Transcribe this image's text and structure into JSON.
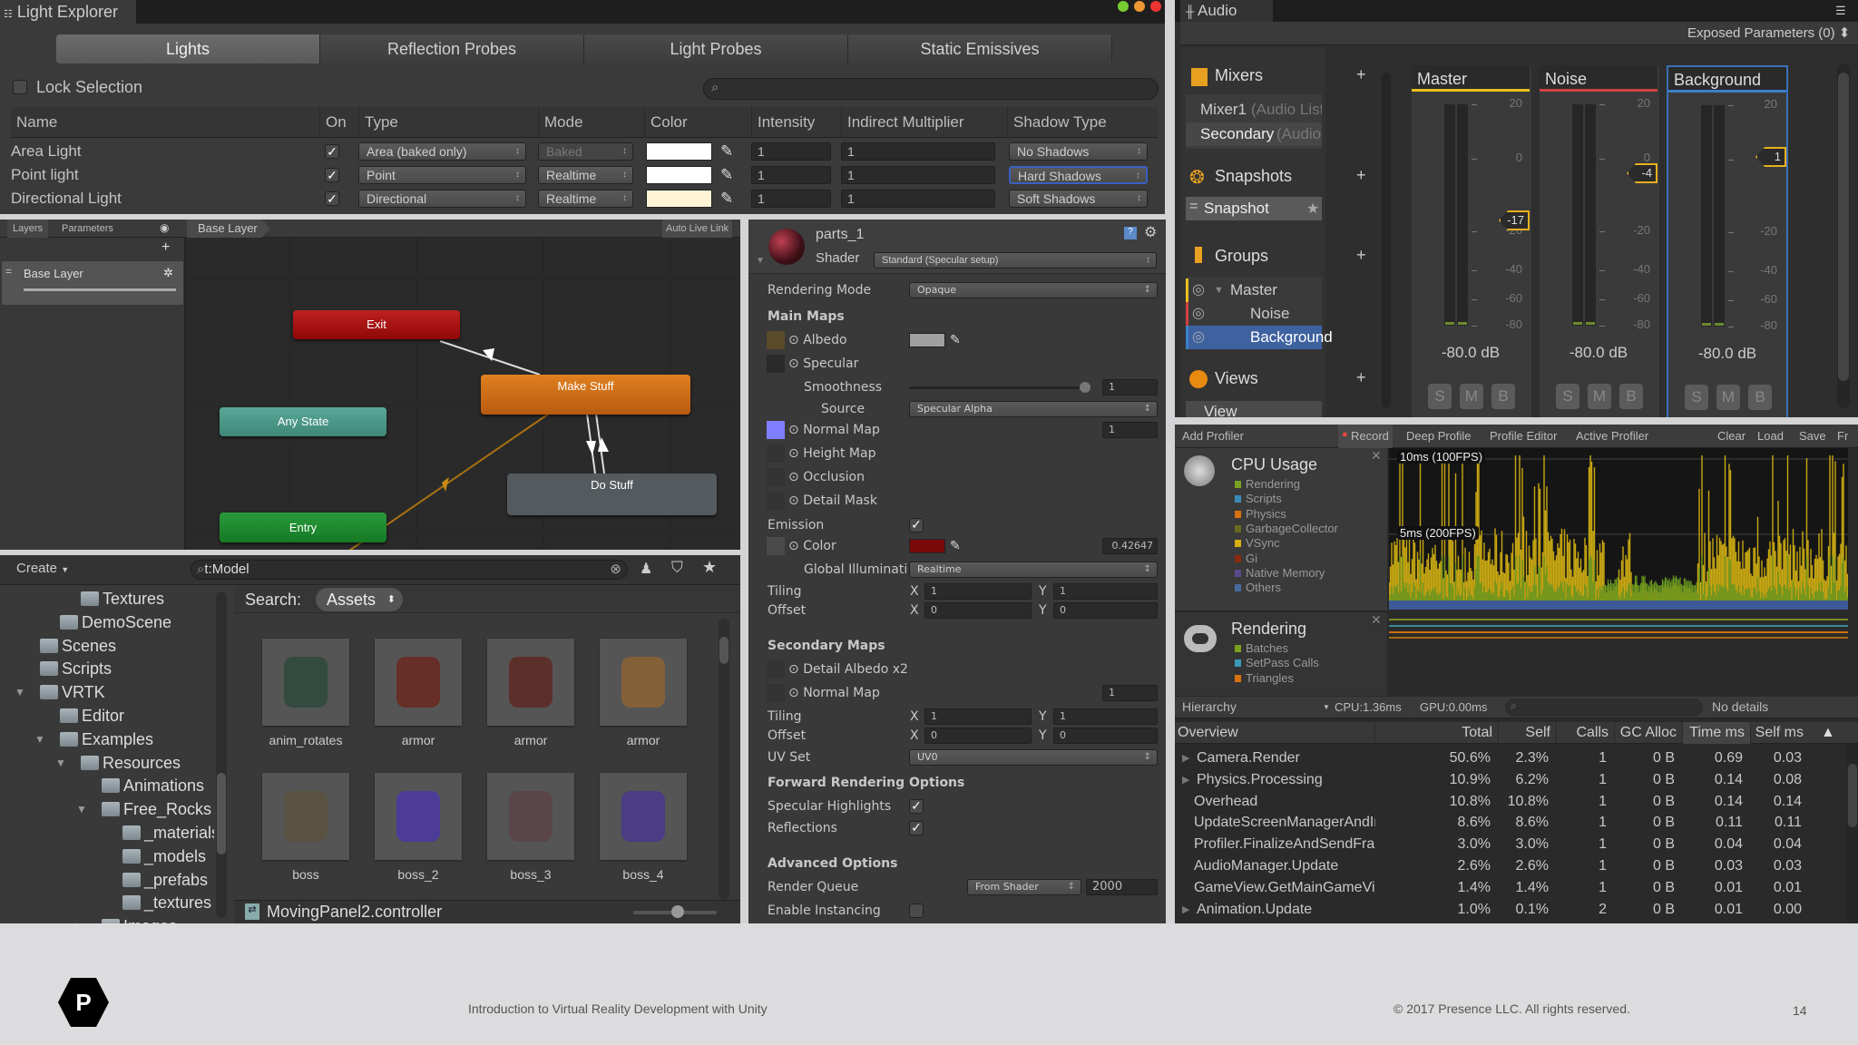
{
  "light_explorer": {
    "title": "Light Explorer",
    "tabs": [
      "Lights",
      "Reflection Probes",
      "Light Probes",
      "Static Emissives"
    ],
    "lock_selection": "Lock Selection",
    "columns": [
      "Name",
      "On",
      "Type",
      "Mode",
      "Color",
      "Intensity",
      "Indirect Multiplier",
      "Shadow Type"
    ],
    "rows": [
      {
        "name": "Area Light",
        "on": true,
        "type": "Area (baked only)",
        "mode": "Baked",
        "color": "#ffffff",
        "intensity": "1",
        "indirect": "1",
        "shadow": "No Shadows"
      },
      {
        "name": "Point light",
        "on": true,
        "type": "Point",
        "mode": "Realtime",
        "color": "#ffffff",
        "intensity": "1",
        "indirect": "1",
        "shadow": "Hard Shadows"
      },
      {
        "name": "Directional Light",
        "on": true,
        "type": "Directional",
        "mode": "Realtime",
        "color": "#fff4d6",
        "intensity": "1",
        "indirect": "1",
        "shadow": "Soft Shadows"
      }
    ]
  },
  "animator": {
    "tabs": [
      "Layers",
      "Parameters"
    ],
    "breadcrumb": "Base Layer",
    "auto_live_link": "Auto Live Link",
    "layer_name": "Base Layer",
    "states": {
      "exit": "Exit",
      "make_stuff": "Make Stuff",
      "any_state": "Any State",
      "do_stuff": "Do Stuff",
      "entry": "Entry"
    }
  },
  "project": {
    "create": "Create",
    "search_value": "t:Model",
    "tree": [
      {
        "label": "Textures",
        "depth": 3,
        "arrow": ""
      },
      {
        "label": "DemoScene",
        "depth": 2,
        "arrow": ""
      },
      {
        "label": "Scenes",
        "depth": 1,
        "arrow": ""
      },
      {
        "label": "Scripts",
        "depth": 1,
        "arrow": ""
      },
      {
        "label": "VRTK",
        "depth": 1,
        "arrow": "▼"
      },
      {
        "label": "Editor",
        "depth": 2,
        "arrow": ""
      },
      {
        "label": "Examples",
        "depth": 2,
        "arrow": "▼"
      },
      {
        "label": "Resources",
        "depth": 3,
        "arrow": "▼"
      },
      {
        "label": "Animations",
        "depth": 4,
        "arrow": ""
      },
      {
        "label": "Free_Rocks",
        "depth": 4,
        "arrow": "▼"
      },
      {
        "label": "_materials",
        "depth": 5,
        "arrow": ""
      },
      {
        "label": "_models",
        "depth": 5,
        "arrow": ""
      },
      {
        "label": "_prefabs",
        "depth": 5,
        "arrow": ""
      },
      {
        "label": "_textures",
        "depth": 5,
        "arrow": ""
      },
      {
        "label": "Images",
        "depth": 4,
        "arrow": "▶"
      }
    ],
    "search_label": "Search:",
    "search_scope": "Assets",
    "assets": [
      {
        "label": "anim_rotates",
        "tint": "#2f4a3c"
      },
      {
        "label": "armor",
        "tint": "#6a2a24"
      },
      {
        "label": "armor",
        "tint": "#5e2b26"
      },
      {
        "label": "armor",
        "tint": "#8a6236"
      },
      {
        "label": "boss",
        "tint": "#5a5140"
      },
      {
        "label": "boss_2",
        "tint": "#4b3aa0"
      },
      {
        "label": "boss_3",
        "tint": "#5b4448"
      },
      {
        "label": "boss_4",
        "tint": "#4a3a8a"
      }
    ],
    "selected_file": "MovingPanel2.controller"
  },
  "inspector": {
    "material": "parts_1",
    "shader_label": "Shader",
    "shader": "Standard (Specular setup)",
    "rendering_mode_label": "Rendering Mode",
    "rendering_mode": "Opaque",
    "main_maps": "Main Maps",
    "albedo": "Albedo",
    "specular": "Specular",
    "smoothness": "Smoothness",
    "smoothness_value": "1",
    "smoothness_fraction": 1.0,
    "source": "Source",
    "source_value": "Specular Alpha",
    "normal_map": "Normal Map",
    "normal_value": "1",
    "height_map": "Height Map",
    "occlusion": "Occlusion",
    "detail_mask": "Detail Mask",
    "emission": "Emission",
    "emission_color_label": "Color",
    "emission_value": "0.42647",
    "gi_label": "Global Illuminati",
    "gi_value": "Realtime",
    "tiling": "Tiling",
    "offset": "Offset",
    "x": "X",
    "y": "Y",
    "main_tiling": [
      "1",
      "1"
    ],
    "main_offset": [
      "0",
      "0"
    ],
    "secondary_maps": "Secondary Maps",
    "detail_albedo": "Detail Albedo x2",
    "secondary_normal": "Normal Map",
    "secondary_normal_value": "1",
    "secondary_tiling": [
      "1",
      "1"
    ],
    "secondary_offset": [
      "0",
      "0"
    ],
    "uv_set": "UV Set",
    "uv_set_value": "UV0",
    "forward_options": "Forward Rendering Options",
    "specular_highlights": "Specular Highlights",
    "reflections": "Reflections",
    "advanced_options": "Advanced Options",
    "render_queue": "Render Queue",
    "render_queue_mode": "From Shader",
    "render_queue_value": "2000",
    "enable_instancing": "Enable Instancing",
    "colors": {
      "albedo": "#a0a0a0",
      "emission": "#7a0a0a",
      "normal": "#7f7fff"
    }
  },
  "audio_mixer": {
    "title": "Audio Mixer",
    "exposed_parameters": "Exposed Parameters (0)",
    "mixers_title": "Mixers",
    "mixers": [
      {
        "name": "Mixer1",
        "detail": "(Audio Listener)"
      },
      {
        "name": "Secondary",
        "detail": "(Audio Listener)"
      }
    ],
    "snapshots_title": "Snapshots",
    "snapshot": "Snapshot",
    "groups_title": "Groups",
    "groups": [
      {
        "name": "Master",
        "color": "#e8c020",
        "selected": false
      },
      {
        "name": "Noise",
        "color": "#d04040",
        "selected": false
      },
      {
        "name": "Background",
        "color": "#3a80c8",
        "selected": true
      }
    ],
    "views_title": "Views",
    "view": "View",
    "scale": [
      "20",
      "0",
      "-20",
      "-40",
      "-60",
      "-80"
    ],
    "strips": [
      {
        "name": "Master",
        "color": "#e8c020",
        "fader": "-17",
        "fader_db": -17,
        "level": "-80.0 dB"
      },
      {
        "name": "Noise",
        "color": "#d04040",
        "fader": "-4",
        "fader_db": -4,
        "level": "-80.0 dB"
      },
      {
        "name": "Background",
        "color": "#3a80c8",
        "fader": "1",
        "fader_db": 1,
        "level": "-80.0 dB"
      }
    ],
    "smb": [
      "S",
      "M",
      "B"
    ]
  },
  "profiler": {
    "toolbar": [
      "Add Profiler",
      "Record",
      "Deep Profile",
      "Profile Editor",
      "Active Profiler",
      "Clear",
      "Load",
      "Save",
      "Fr"
    ],
    "cpu_title": "CPU Usage",
    "cpu_legend": [
      {
        "label": "Rendering",
        "color": "#7aa020"
      },
      {
        "label": "Scripts",
        "color": "#3a8ab8"
      },
      {
        "label": "Physics",
        "color": "#d87010"
      },
      {
        "label": "GarbageCollector",
        "color": "#6a6a20"
      },
      {
        "label": "VSync",
        "color": "#d8b010"
      },
      {
        "label": "Gi",
        "color": "#8a2a10"
      },
      {
        "label": "Native Memory",
        "color": "#5a4a8a"
      },
      {
        "label": "Others",
        "color": "#4a6aa0"
      }
    ],
    "line_10ms": "10ms (100FPS)",
    "line_5ms": "5ms (200FPS)",
    "rendering_title": "Rendering",
    "rendering_legend": [
      {
        "label": "Batches",
        "color": "#7aa020"
      },
      {
        "label": "SetPass Calls",
        "color": "#3a9ab8"
      },
      {
        "label": "Triangles",
        "color": "#d87010"
      }
    ],
    "hierarchy": "Hierarchy",
    "cpu_time": "CPU:1.36ms",
    "gpu_time": "GPU:0.00ms",
    "details": "No details",
    "columns": [
      "Overview",
      "Total",
      "Self",
      "Calls",
      "GC Alloc",
      "Time ms",
      "Self ms"
    ],
    "rows": [
      {
        "name": "Camera.Render",
        "expand": true,
        "total": "50.6%",
        "self": "2.3%",
        "calls": "1",
        "gc": "0 B",
        "time": "0.69",
        "selfms": "0.03"
      },
      {
        "name": "Physics.Processing",
        "expand": true,
        "total": "10.9%",
        "self": "6.2%",
        "calls": "1",
        "gc": "0 B",
        "time": "0.14",
        "selfms": "0.08"
      },
      {
        "name": "Overhead",
        "expand": false,
        "total": "10.8%",
        "self": "10.8%",
        "calls": "1",
        "gc": "0 B",
        "time": "0.14",
        "selfms": "0.14"
      },
      {
        "name": "UpdateScreenManagerAndInput",
        "expand": false,
        "total": "8.6%",
        "self": "8.6%",
        "calls": "1",
        "gc": "0 B",
        "time": "0.11",
        "selfms": "0.11"
      },
      {
        "name": "Profiler.FinalizeAndSendFrame",
        "expand": false,
        "total": "3.0%",
        "self": "3.0%",
        "calls": "1",
        "gc": "0 B",
        "time": "0.04",
        "selfms": "0.04"
      },
      {
        "name": "AudioManager.Update",
        "expand": false,
        "total": "2.6%",
        "self": "2.6%",
        "calls": "1",
        "gc": "0 B",
        "time": "0.03",
        "selfms": "0.03"
      },
      {
        "name": "GameView.GetMainGameViewTargetS",
        "expand": false,
        "total": "1.4%",
        "self": "1.4%",
        "calls": "1",
        "gc": "0 B",
        "time": "0.01",
        "selfms": "0.01"
      },
      {
        "name": "Animation.Update",
        "expand": true,
        "total": "1.0%",
        "self": "0.1%",
        "calls": "2",
        "gc": "0 B",
        "time": "0.01",
        "selfms": "0.00"
      }
    ]
  },
  "footer": {
    "course": "Introduction to Virtual Reality Development with Unity",
    "copyright": "© 2017 Presence LLC. All rights reserved.",
    "page": "14",
    "logo_letter": "P"
  }
}
